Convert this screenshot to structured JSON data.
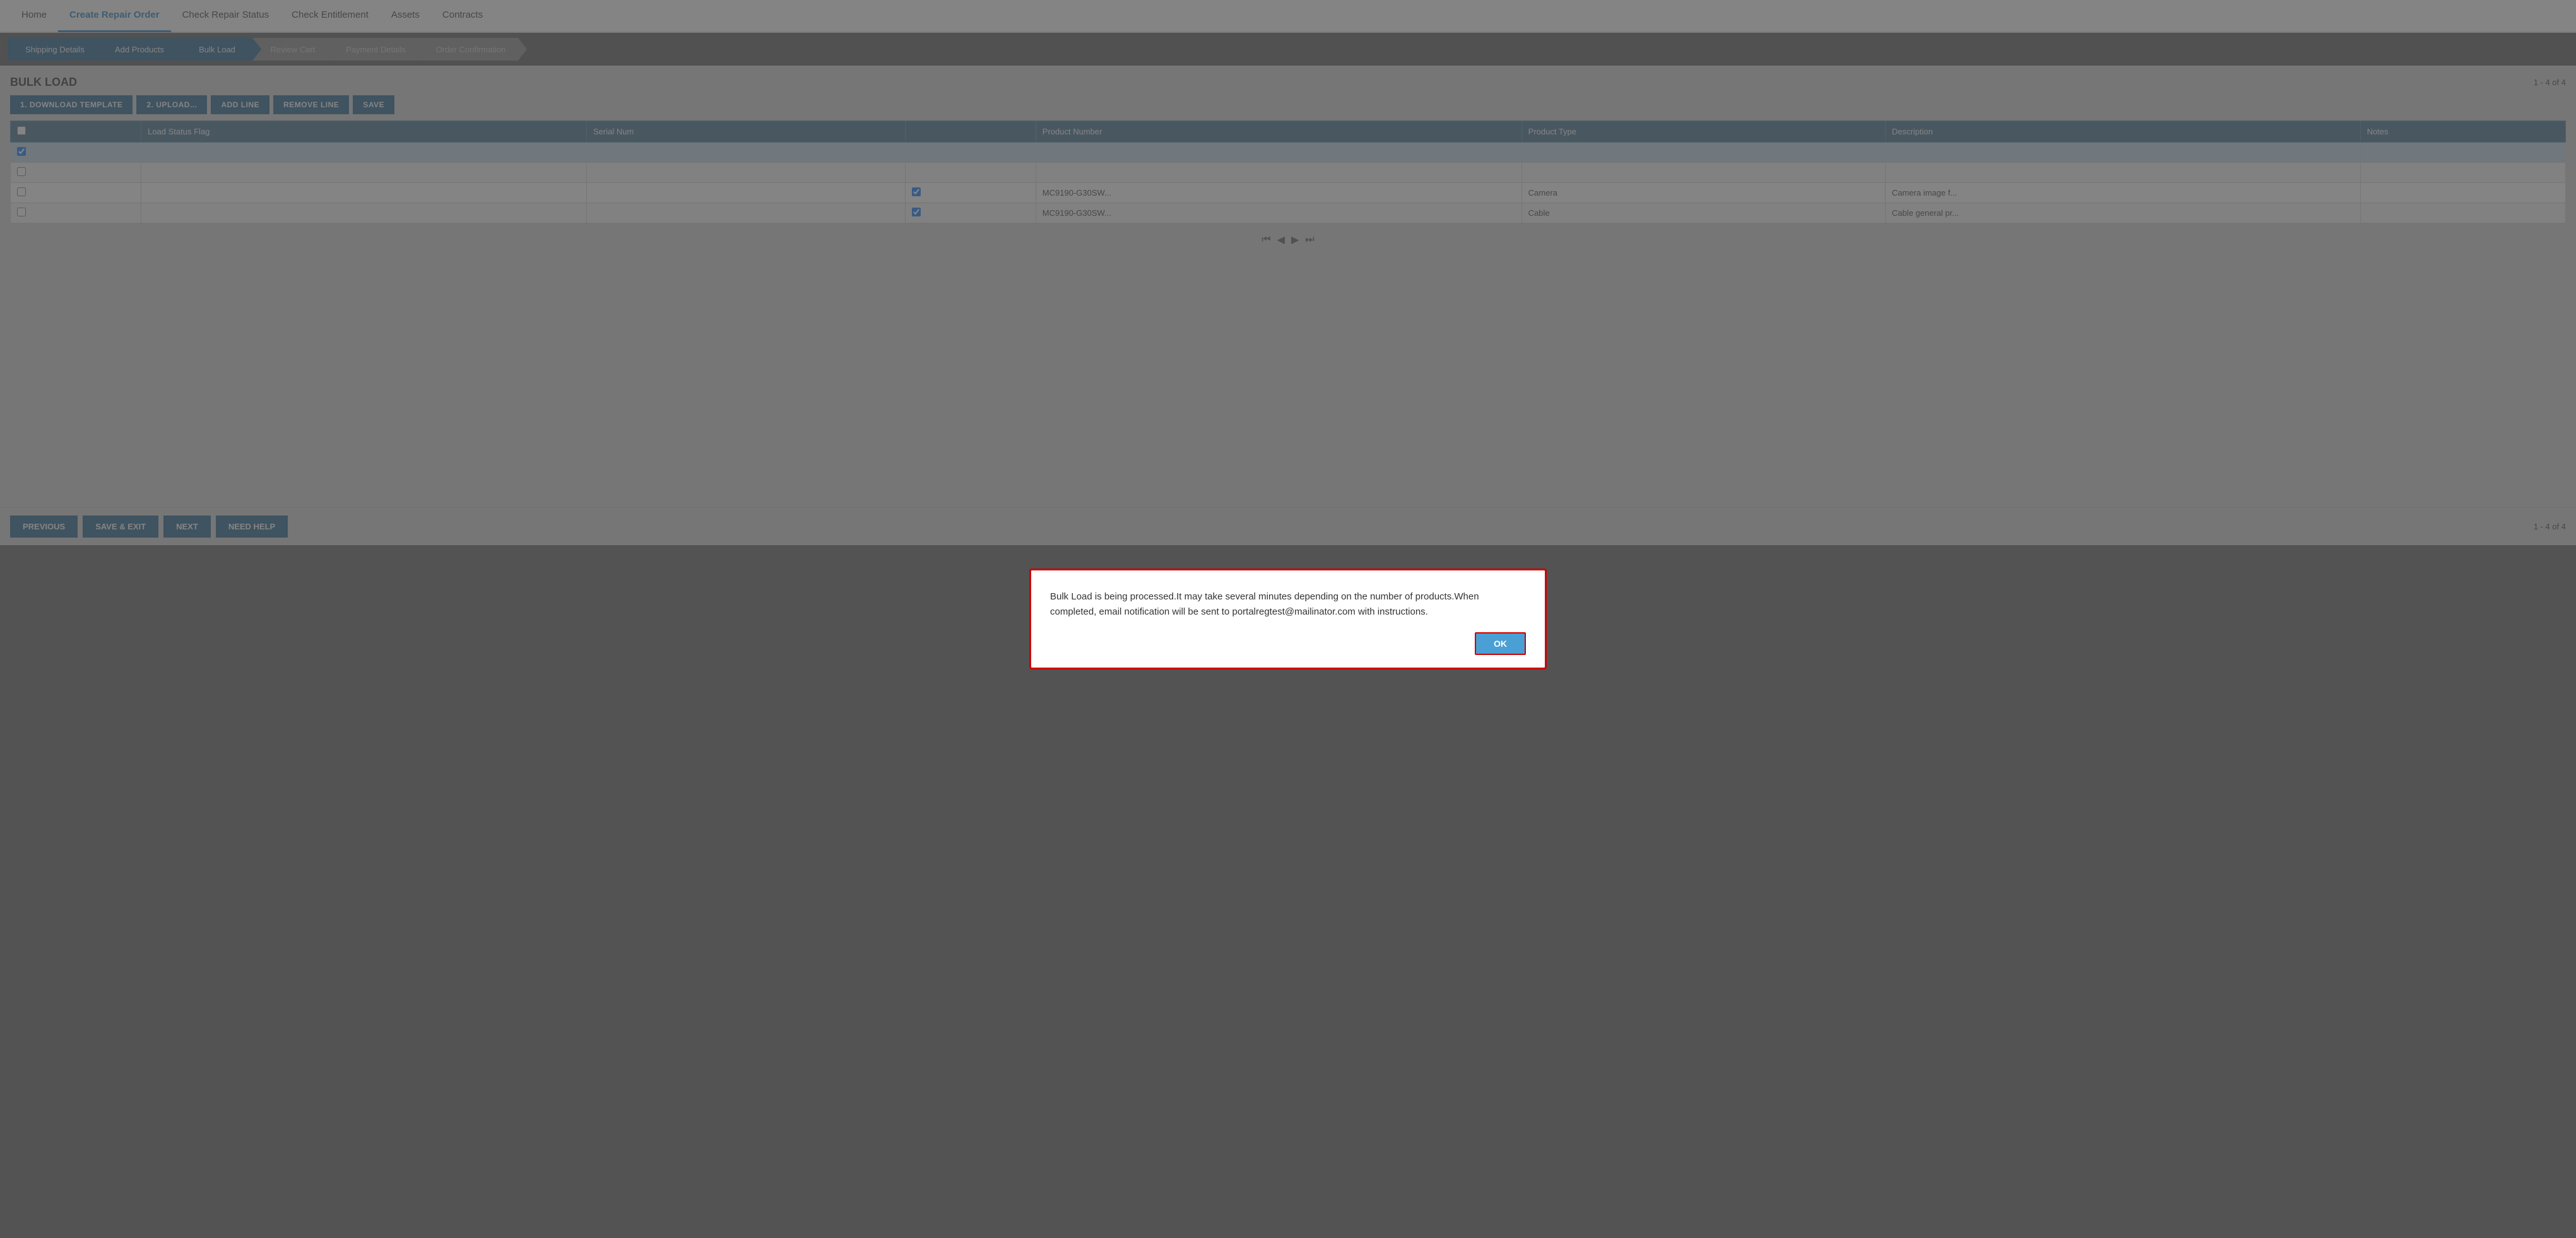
{
  "nav": {
    "items": [
      {
        "id": "home",
        "label": "Home",
        "active": false
      },
      {
        "id": "create-repair-order",
        "label": "Create Repair Order",
        "active": true
      },
      {
        "id": "check-repair-status",
        "label": "Check Repair Status",
        "active": false
      },
      {
        "id": "check-entitlement",
        "label": "Check Entitlement",
        "active": false
      },
      {
        "id": "assets",
        "label": "Assets",
        "active": false
      },
      {
        "id": "contracts",
        "label": "Contracts",
        "active": false
      }
    ]
  },
  "steps": [
    {
      "id": "shipping-details",
      "label": "Shipping Details",
      "state": "completed"
    },
    {
      "id": "add-products",
      "label": "Add Products",
      "state": "completed"
    },
    {
      "id": "bulk-load",
      "label": "Bulk Load",
      "state": "active"
    },
    {
      "id": "review-cart",
      "label": "Review Cart",
      "state": "inactive"
    },
    {
      "id": "payment-details",
      "label": "Payment Details",
      "state": "inactive"
    },
    {
      "id": "order-confirmation",
      "label": "Order Confirmation",
      "state": "inactive"
    }
  ],
  "page": {
    "title": "BULK LOAD",
    "pagination": "1 - 4 of 4"
  },
  "toolbar": {
    "btn1": "1. DOWNLOAD TEMPLATE",
    "btn2": "2. UPLOAD...",
    "btn_add_line": "ADD LINE",
    "btn_remove_line": "REMOVE LINE",
    "btn_save": "SAVE"
  },
  "table": {
    "headers": [
      "",
      "Load Status Flag",
      "Serial Num",
      "",
      "Product Number",
      "Product Type",
      "Description",
      "Notes"
    ],
    "rows": [
      {
        "selected": true,
        "status_flag": "",
        "serial_num": "",
        "checkbox2": false,
        "product_num": "",
        "product_type": "",
        "description": "",
        "notes": ""
      },
      {
        "selected": false,
        "status_flag": "",
        "serial_num": "",
        "checkbox2": false,
        "product_num": "",
        "product_type": "",
        "description": "",
        "notes": ""
      },
      {
        "selected": false,
        "status_flag": "",
        "serial_num": "",
        "checkbox2": true,
        "product_num": "MC9190-G30SW...",
        "product_type": "Camera",
        "description": "Camera image f...",
        "notes": ""
      },
      {
        "selected": false,
        "status_flag": "",
        "serial_num": "",
        "checkbox2": true,
        "product_num": "MC9190-G30SW...",
        "product_type": "Cable",
        "description": "Cable general pr...",
        "notes": ""
      }
    ]
  },
  "pagination_controls": {
    "first": "⏮",
    "prev": "◀",
    "next": "▶",
    "last": "⏭"
  },
  "bottom": {
    "btn_previous": "PREVIOUS",
    "btn_save_exit": "SAVE & EXIT",
    "btn_next": "NEXT",
    "btn_need_help": "NEED HELP",
    "pagination": "1 - 4 of 4"
  },
  "dialog": {
    "message": "Bulk Load is being processed.It may take several minutes depending on the number of products.When completed, email notification will be sent to portalregtest@mailinator.com with instructions.",
    "ok_label": "OK"
  }
}
